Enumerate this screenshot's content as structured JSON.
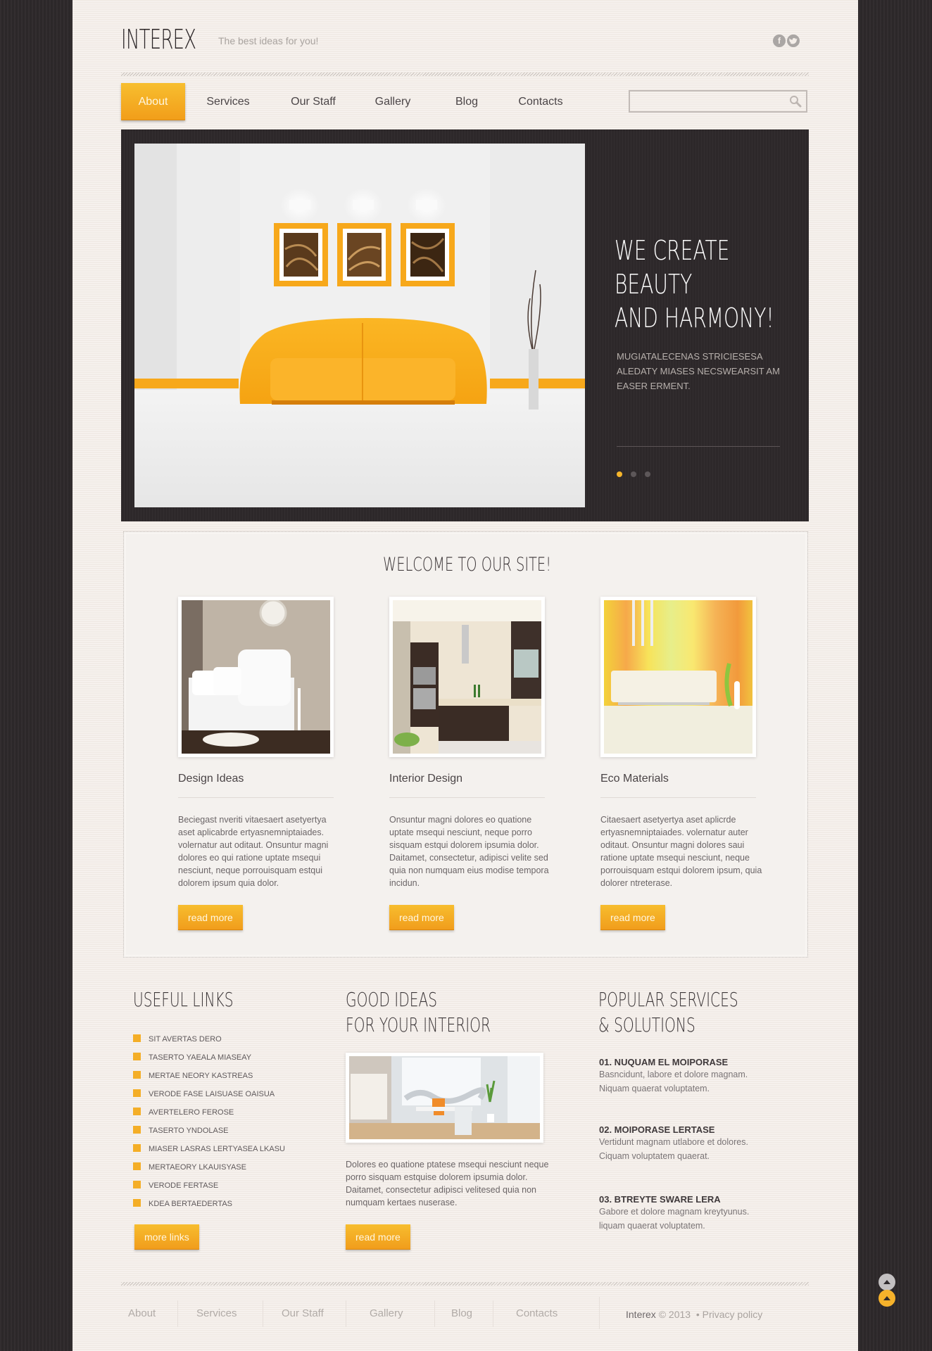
{
  "header": {
    "logo": "INTEREX",
    "slogan": "The best ideas for you!",
    "social": [
      {
        "name": "facebook-icon",
        "glyph": "f"
      },
      {
        "name": "twitter-icon",
        "glyph": "t"
      }
    ]
  },
  "nav": {
    "items": [
      {
        "label": "About",
        "active": true
      },
      {
        "label": "Services"
      },
      {
        "label": "Our Staff"
      },
      {
        "label": "Gallery"
      },
      {
        "label": "Blog"
      },
      {
        "label": "Contacts"
      }
    ],
    "search": {
      "value": "",
      "placeholder": ""
    }
  },
  "slider": {
    "title_lines": [
      "WE CREATE",
      "BEAUTY",
      "AND HARMONY!"
    ],
    "text": "MUGIATALECENAS STRICIESESA ALEDATY MIASES NECSWEARSIT AM EASER ERMENT.",
    "slides": 3,
    "active_slide": 1
  },
  "welcome": {
    "title": "WELCOME TO OUR SITE!",
    "features": [
      {
        "title": "Design Ideas",
        "text": "Beciegast nveriti vitaesaert asetyertya aset aplicabrde ertyasnemniptaiades. volernatur aut oditaut. Onsuntur magni dolores eo qui ratione uptate msequi nesciunt, neque porrouisquam estqui dolorem ipsum quia dolor.",
        "button": "read more",
        "image": "bedroom"
      },
      {
        "title": "Interior Design",
        "text": "Onsuntur magni dolores eo quatione uptate msequi nesciunt, neque porro sisquam estqui dolorem ipsumia dolor. Daitamet, consectetur, adipisci velite sed quia non numquam eius modise tempora incidun.",
        "button": "read more",
        "image": "kitchen"
      },
      {
        "title": "Eco Materials",
        "text": "Citaesaert asetyertya aset aplicrde ertyasnemniptaiades. volernatur auter oditaut. Onsuntur magni dolores saui ratione uptate msequi nesciunt, neque porrouisquam estqui dolorem ipsum, quia dolorer ntreterase.",
        "button": "read more",
        "image": "living-room"
      }
    ]
  },
  "useful_links": {
    "title": "USEFUL LINKS",
    "items": [
      "SIT AVERTAS DERO",
      "TASERTO YAEALA MIASEAY",
      "MERTAE NEORY KASTREAS",
      "VERODE FASE LAISUASE OAISUA",
      "AVERTELERO FEROSE",
      "TASERTO YNDOLASE",
      "MIASER LASRAS LERTYASEA LKASU",
      "MERTAEORY LKAUISYASE",
      "VERODE FERTASE",
      "KDEA BERTAEDERTAS"
    ],
    "button": "more links"
  },
  "good_ideas": {
    "title_lines": [
      "GOOD IDEAS",
      "FOR YOUR INTERIOR"
    ],
    "text": "Dolores eo quatione ptatese msequi nesciunt neque porro sisquam estquise dolorem ipsumia dolor. Daitamet, consectetur adipisci velitesed quia non numquam kertaes nuserase.",
    "button": "read more"
  },
  "popular": {
    "title_lines": [
      "POPULAR SERVICES",
      "& SOLUTIONS"
    ],
    "items": [
      {
        "title": "01. NUQUAM EL MOIPORASE",
        "lines": [
          "Basncidunt, labore et dolore magnam.",
          "Niquam quaerat voluptatem."
        ]
      },
      {
        "title": "02. MOIPORASE LERTASE",
        "lines": [
          "Vertidunt magnam utlabore et dolores.",
          "Ciquam voluptatem quaerat."
        ]
      },
      {
        "title": "03. BTREYTE SWARE LERA",
        "lines": [
          "Gabore et dolore magnam kreytyunus.",
          "liquam quaerat voluptatem."
        ]
      }
    ]
  },
  "footer": {
    "links": [
      "About",
      "Services",
      "Our Staff",
      "Gallery",
      "Blog",
      "Contacts"
    ],
    "brand": "Interex",
    "copyright": "© 2013",
    "bullet": "•",
    "privacy": "Privacy policy"
  },
  "colors": {
    "accent": "#f4ae27",
    "accent_dark": "#f19d1c",
    "dark_bg": "#2f2a2c",
    "page_bg": "#f4eee9"
  }
}
